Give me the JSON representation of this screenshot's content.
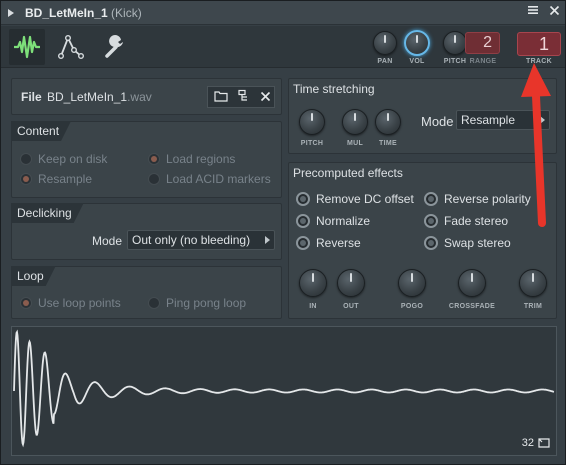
{
  "window": {
    "title": "BD_LetMeIn_1",
    "subtitle": "(Kick)",
    "detach_icon": "hamburger-icon",
    "close_icon": "close-icon"
  },
  "toolbar": {
    "tabs": [
      {
        "icon": "waveform-icon",
        "active": true
      },
      {
        "icon": "envelope-icon",
        "active": false
      },
      {
        "icon": "wrench-icon",
        "active": false
      }
    ],
    "knobs": [
      {
        "label": "PAN"
      },
      {
        "label": "VOL"
      },
      {
        "label": "PITCH"
      }
    ],
    "range_label": "RANGE",
    "range_value": "2",
    "track_label": "TRACK",
    "track_value": "1"
  },
  "file": {
    "label": "File",
    "name": "BD_LetMeIn_1",
    "ext": ".wav"
  },
  "content": {
    "heading": "Content",
    "options": [
      {
        "label": "Keep on disk",
        "checked": false
      },
      {
        "label": "Load regions",
        "checked": true
      },
      {
        "label": "Resample",
        "checked": true
      },
      {
        "label": "Load ACID markers",
        "checked": false
      }
    ]
  },
  "declicking": {
    "heading": "Declicking",
    "mode_label": "Mode",
    "mode_value": "Out only (no bleeding)"
  },
  "loop": {
    "heading": "Loop",
    "options": [
      {
        "label": "Use loop points",
        "checked": true
      },
      {
        "label": "Ping pong loop",
        "checked": false
      }
    ]
  },
  "time_stretching": {
    "heading": "Time stretching",
    "knobs": [
      "PITCH",
      "MUL",
      "TIME"
    ],
    "mode_label": "Mode",
    "mode_value": "Resample"
  },
  "precomputed": {
    "heading": "Precomputed effects",
    "options": [
      {
        "label": "Remove DC offset"
      },
      {
        "label": "Reverse polarity"
      },
      {
        "label": "Normalize"
      },
      {
        "label": "Fade stereo"
      },
      {
        "label": "Reverse"
      },
      {
        "label": "Swap stereo"
      }
    ],
    "knobs": [
      "IN",
      "OUT",
      "POGO",
      "CROSSFADE",
      "TRIM"
    ]
  },
  "waveform": {
    "zoom_value": "32"
  },
  "colors": {
    "accent_green": "#7ee07a",
    "knob_highlight": "#66b8e8",
    "track_red": "#7a2e36",
    "annotation_arrow": "#e8352a"
  }
}
